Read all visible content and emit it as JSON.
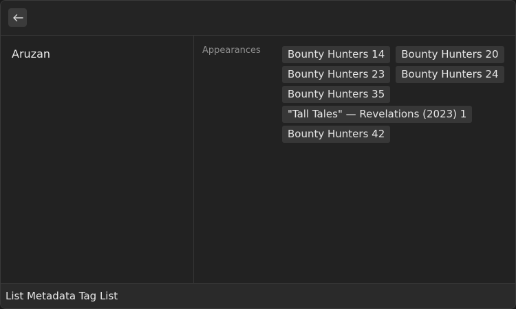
{
  "header": {
    "back_icon": "arrow-left-icon"
  },
  "left": {
    "item_name": "Aruzan"
  },
  "right": {
    "field_label": "Appearances",
    "tags": [
      "Bounty Hunters 14",
      "Bounty Hunters 20",
      "Bounty Hunters 23",
      "Bounty Hunters 24",
      "Bounty Hunters 35",
      "\"Tall Tales\" — Revelations (2023) 1",
      "Bounty Hunters 42"
    ]
  },
  "footer": {
    "text": "List Metadata Tag List"
  },
  "colors": {
    "background": "#222222",
    "tag_background": "#373737",
    "label_text": "#8e8e8e"
  }
}
